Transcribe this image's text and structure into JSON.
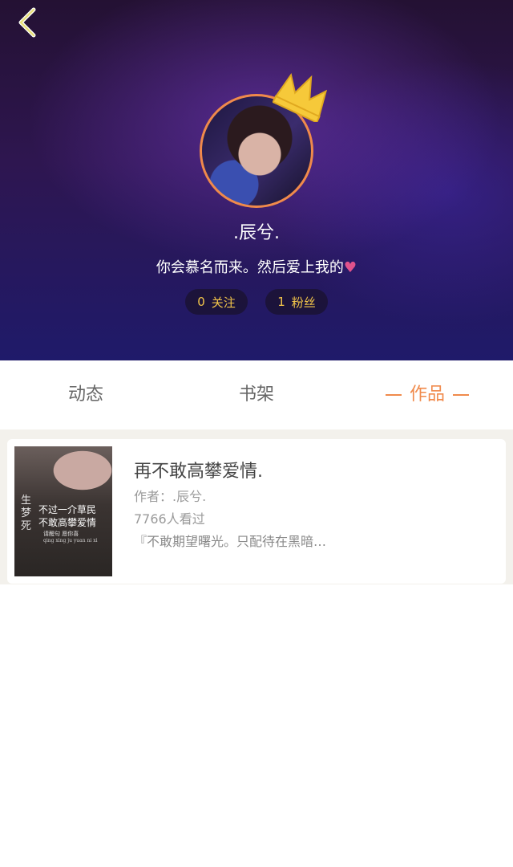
{
  "profile": {
    "nickname": ".辰兮.",
    "signature": "你会慕名而来。然后爱上我的",
    "heart_glyph": "♥",
    "following": {
      "count": "0",
      "label": "关注"
    },
    "fans": {
      "count": "1",
      "label": "粉丝"
    }
  },
  "tabs": [
    {
      "label": "动态",
      "active": false
    },
    {
      "label": "书架",
      "active": false
    },
    {
      "label": "作品",
      "active": true
    }
  ],
  "works": [
    {
      "title": "再不敢高攀爱情.",
      "author": "作者：.辰兮.",
      "views": "7766人看过",
      "excerpt": "『不敢期望曙光。只配待在黑暗…",
      "cover": {
        "vertical_text": "生梦死",
        "line1": "不过一介草民",
        "line2": "不敢高攀爱情",
        "line3": "请醒句 愿你喜",
        "line4": "qing xing ju  yuan ni xi"
      }
    }
  ],
  "colors": {
    "accent": "#f08a4b",
    "badge_text": "#f3c64a",
    "heart": "#e0528c"
  },
  "icons": [
    "back-icon",
    "crown-icon",
    "heart-icon"
  ]
}
